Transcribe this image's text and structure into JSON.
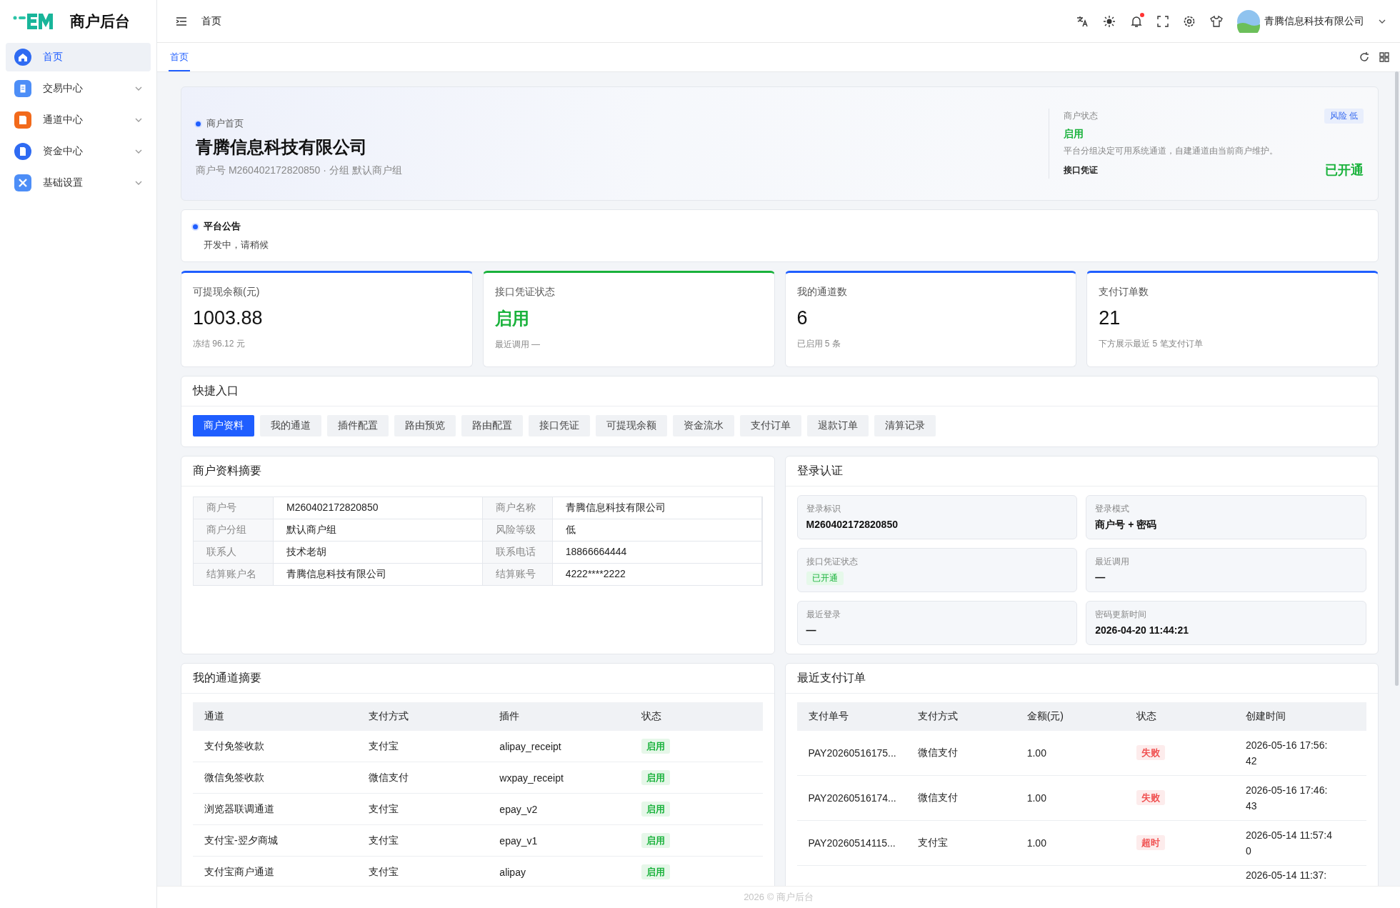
{
  "brand": {
    "title": "商户后台"
  },
  "sidebar": {
    "items": [
      {
        "label": "首页",
        "selected": true,
        "expandable": false
      },
      {
        "label": "交易中心",
        "selected": false,
        "expandable": true
      },
      {
        "label": "通道中心",
        "selected": false,
        "expandable": true
      },
      {
        "label": "资金中心",
        "selected": false,
        "expandable": true
      },
      {
        "label": "基础设置",
        "selected": false,
        "expandable": true
      }
    ]
  },
  "topbar": {
    "breadcrumb": "首页",
    "notification_dot": true,
    "user": "青腾信息科技有限公司"
  },
  "tabs": [
    {
      "label": "首页",
      "selected": true
    }
  ],
  "header_card": {
    "eyebrow": "商户首页",
    "title": "青腾信息科技有限公司",
    "subtitle": "商户号 M260402172820850 · 分组 默认商户组",
    "status_label": "商户状态",
    "status_value": "启用",
    "risk_badge": "风险 低",
    "note": "平台分组决定可用系统通道，自建通道由当前商户维护。",
    "credential_label": "接口凭证",
    "credential_value": "已开通"
  },
  "announcement": {
    "title": "平台公告",
    "text": "开发中，请稍候"
  },
  "stats": [
    {
      "label": "可提现余额(元)",
      "value": "1003.88",
      "note": "冻结 96.12 元",
      "color": "#1f5eff"
    },
    {
      "label": "接口凭证状态",
      "value": "启用",
      "note": "最近调用 —",
      "color": "#19b23b"
    },
    {
      "label": "我的通道数",
      "value": "6",
      "note": "已启用 5 条",
      "color": "#1f5eff"
    },
    {
      "label": "支付订单数",
      "value": "21",
      "note": "下方展示最近 5 笔支付订单",
      "color": "#1f5eff"
    }
  ],
  "quick_entry": {
    "title": "快捷入口",
    "buttons": [
      {
        "label": "商户资料",
        "selected": true
      },
      {
        "label": "我的通道",
        "selected": false
      },
      {
        "label": "插件配置",
        "selected": false
      },
      {
        "label": "路由预览",
        "selected": false
      },
      {
        "label": "路由配置",
        "selected": false
      },
      {
        "label": "接口凭证",
        "selected": false
      },
      {
        "label": "可提现余额",
        "selected": false
      },
      {
        "label": "资金流水",
        "selected": false
      },
      {
        "label": "支付订单",
        "selected": false
      },
      {
        "label": "退款订单",
        "selected": false
      },
      {
        "label": "清算记录",
        "selected": false
      }
    ]
  },
  "profile": {
    "title": "商户资料摘要",
    "rows": [
      [
        "商户号",
        "M260402172820850",
        "商户名称",
        "青腾信息科技有限公司"
      ],
      [
        "商户分组",
        "默认商户组",
        "风险等级",
        "低"
      ],
      [
        "联系人",
        "技术老胡",
        "联系电话",
        "18866664444"
      ],
      [
        "结算账户名",
        "青腾信息科技有限公司",
        "结算账号",
        "4222****2222"
      ]
    ]
  },
  "login": {
    "title": "登录认证",
    "items": [
      {
        "label": "登录标识",
        "value": "M260402172820850",
        "kind": "text"
      },
      {
        "label": "登录模式",
        "value": "商户号 + 密码",
        "kind": "text"
      },
      {
        "label": "接口凭证状态",
        "value": "已开通",
        "kind": "badge"
      },
      {
        "label": "最近调用",
        "value": "—",
        "kind": "text"
      },
      {
        "label": "最近登录",
        "value": "—",
        "kind": "text"
      },
      {
        "label": "密码更新时间",
        "value": "2026-04-20 11:44:21",
        "kind": "text"
      }
    ]
  },
  "channels": {
    "title": "我的通道摘要",
    "columns": [
      "通道",
      "支付方式",
      "插件",
      "状态"
    ],
    "rows": [
      {
        "name": "支付免签收款",
        "method": "支付宝",
        "plugin": "alipay_receipt",
        "status": "启用",
        "color": "#19b23b"
      },
      {
        "name": "微信免签收款",
        "method": "微信支付",
        "plugin": "wxpay_receipt",
        "status": "启用",
        "color": "#19b23b"
      },
      {
        "name": "浏览器联调通道",
        "method": "支付宝",
        "plugin": "epay_v2",
        "status": "启用",
        "color": "#19b23b"
      },
      {
        "name": "支付宝-翌夕商城",
        "method": "支付宝",
        "plugin": "epay_v1",
        "status": "启用",
        "color": "#19b23b"
      },
      {
        "name": "支付宝商户通道",
        "method": "支付宝",
        "plugin": "alipay",
        "status": "启用",
        "color": "#19b23b"
      }
    ]
  },
  "orders": {
    "title": "最近支付订单",
    "columns": [
      "支付单号",
      "支付方式",
      "金额(元)",
      "状态",
      "创建时间"
    ],
    "rows": [
      {
        "id": "PAY20260516175...",
        "method": "微信支付",
        "amount": "1.00",
        "status": "失败",
        "color": "#f05050",
        "time": "2026-05-16 17:56:42"
      },
      {
        "id": "PAY20260516174...",
        "method": "微信支付",
        "amount": "1.00",
        "status": "失败",
        "color": "#f05050",
        "time": "2026-05-16 17:46:43"
      },
      {
        "id": "PAY20260514115...",
        "method": "支付宝",
        "amount": "1.00",
        "status": "超时",
        "color": "#f05050",
        "time": "2026-05-14 11:57:40"
      },
      {
        "time": "2026-05-14 11:37:"
      }
    ]
  },
  "footer": "2026 © 商户后台"
}
